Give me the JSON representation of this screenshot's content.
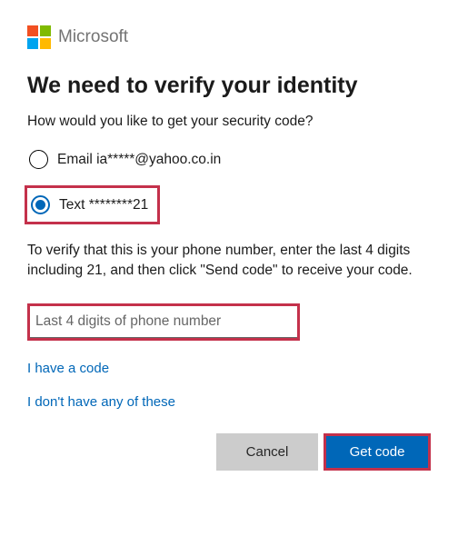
{
  "brand": "Microsoft",
  "heading": "We need to verify your identity",
  "prompt": "How would you like to get your security code?",
  "options": {
    "email": {
      "label": "Email ia*****@yahoo.co.in",
      "selected": false
    },
    "text": {
      "label": "Text ********21",
      "selected": true
    }
  },
  "instructions": "To verify that this is your phone number, enter the last 4 digits including 21, and then click \"Send code\" to receive your code.",
  "input": {
    "placeholder": "Last 4 digits of phone number",
    "value": ""
  },
  "links": {
    "have_code": "I have a code",
    "none": "I don't have any of these"
  },
  "buttons": {
    "cancel": "Cancel",
    "submit": "Get code"
  },
  "colors": {
    "accent": "#0067b8",
    "highlight": "#c4314b"
  }
}
